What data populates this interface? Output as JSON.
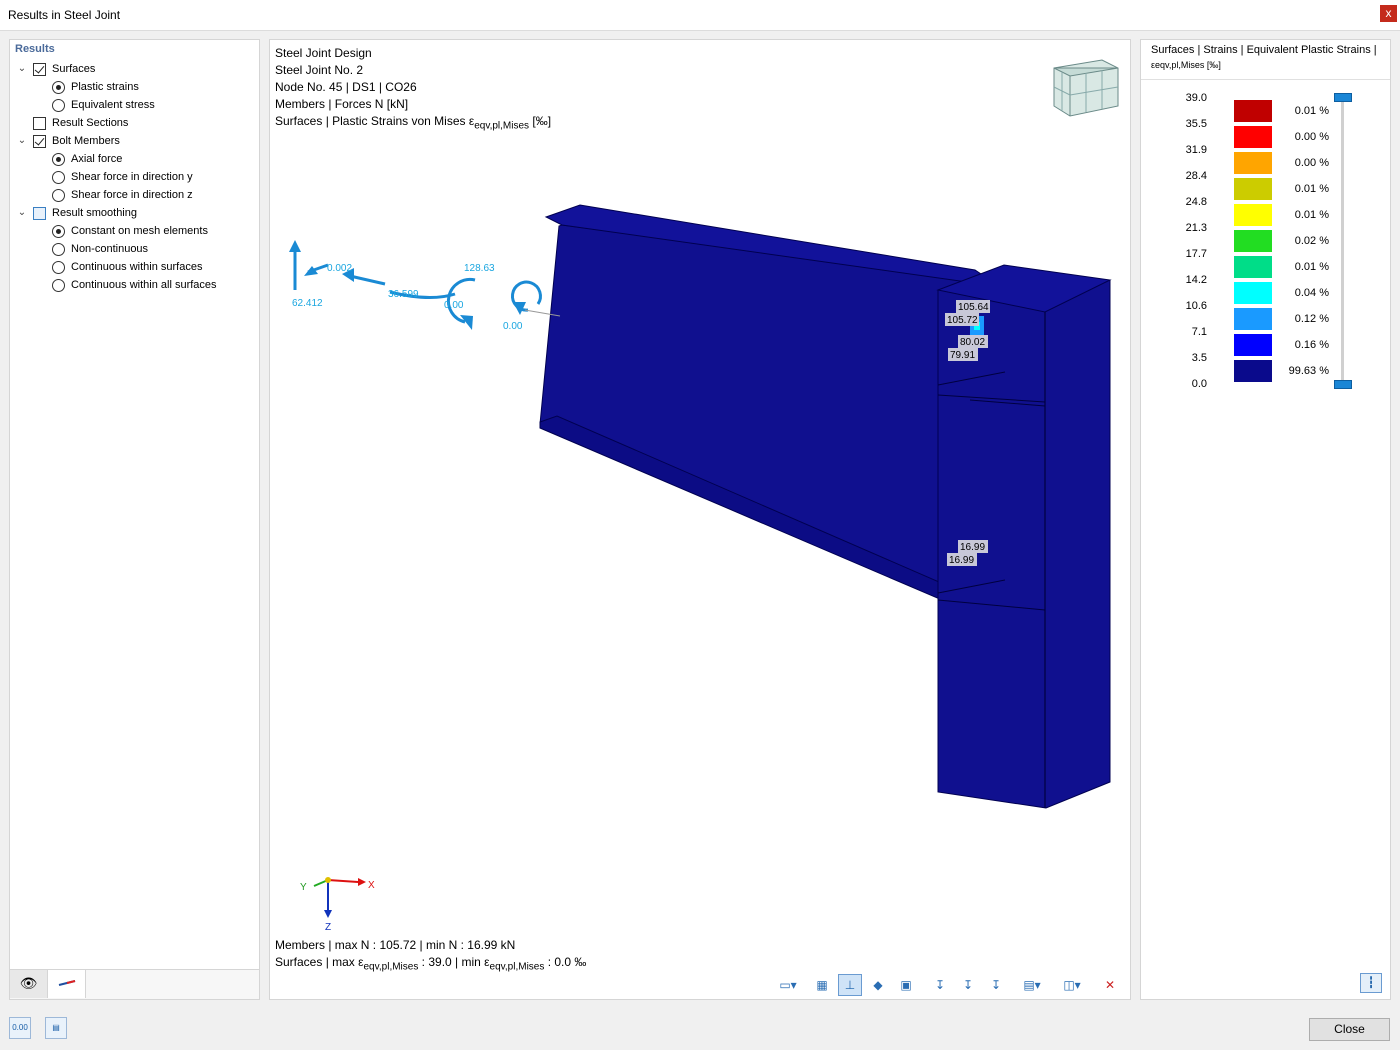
{
  "window": {
    "title": "Results in Steel Joint",
    "close_glyph": "x"
  },
  "tree": {
    "header": "Results",
    "items": [
      {
        "label": "Surfaces",
        "kind": "checkbox",
        "checked": true,
        "expander": true,
        "level": 0
      },
      {
        "label": "Plastic strains",
        "kind": "radio",
        "checked": true,
        "level": 1
      },
      {
        "label": "Equivalent stress",
        "kind": "radio",
        "checked": false,
        "level": 1
      },
      {
        "label": "Result Sections",
        "kind": "checkbox",
        "checked": false,
        "level": 0
      },
      {
        "label": "Bolt Members",
        "kind": "checkbox",
        "checked": true,
        "expander": true,
        "level": 0
      },
      {
        "label": "Axial force",
        "kind": "radio",
        "checked": true,
        "level": 1
      },
      {
        "label": "Shear force in direction y",
        "kind": "radio",
        "checked": false,
        "level": 1
      },
      {
        "label": "Shear force in direction z",
        "kind": "radio",
        "checked": false,
        "level": 1
      },
      {
        "label": "Result smoothing",
        "kind": "checkbox",
        "checked": false,
        "partial": true,
        "expander": true,
        "level": 0
      },
      {
        "label": "Constant on mesh elements",
        "kind": "radio",
        "checked": true,
        "level": 1
      },
      {
        "label": "Non-continuous",
        "kind": "radio",
        "checked": false,
        "level": 1
      },
      {
        "label": "Continuous within surfaces",
        "kind": "radio",
        "checked": false,
        "level": 1
      },
      {
        "label": "Continuous within all surfaces",
        "kind": "radio",
        "checked": false,
        "level": 1
      }
    ]
  },
  "viewport": {
    "info_lines": [
      "Steel Joint Design",
      "Steel Joint No. 2",
      "Node No. 45 | DS1 | CO26",
      "Members | Forces N [kN]"
    ],
    "surfaces_line_prefix": "Surfaces | Plastic Strains von Mises ε",
    "surfaces_line_sub": "eqv,pl,Mises",
    "surfaces_line_suffix": " [‰]",
    "footer_members": "Members | max N : 105.72 | min N : 16.99 kN",
    "footer_surf_a": "Surfaces | max ε",
    "footer_surf_sub1": "eqv,pl,Mises",
    "footer_surf_b": " : 39.0 | min ε",
    "footer_surf_sub2": "eqv,pl,Mises",
    "footer_surf_c": " : 0.0 ‰",
    "load_labels": [
      "0.002",
      "62.412",
      "36.599",
      "0.00",
      "128.63",
      "0.00"
    ],
    "result_labels": [
      "105.64",
      "105.72",
      "80.02",
      "79.91",
      "16.99",
      "16.99"
    ],
    "axis_labels": {
      "x": "X",
      "y": "Y",
      "z": "Z"
    },
    "model_color": "#0f0f96",
    "load_color": "#1a8ad4"
  },
  "legend": {
    "title": "Surfaces | Strains | Equivalent Plastic Strains |",
    "subtitle": "εeqv,pl,Mises [‰]",
    "values": [
      "39.0",
      "35.5",
      "31.9",
      "28.4",
      "24.8",
      "21.3",
      "17.7",
      "14.2",
      "10.6",
      "7.1",
      "3.5",
      "0.0"
    ],
    "bands": [
      {
        "color": "#c00000",
        "pct": "0.01 %"
      },
      {
        "color": "#ff0000",
        "pct": "0.00 %"
      },
      {
        "color": "#ffa500",
        "pct": "0.00 %"
      },
      {
        "color": "#cccc00",
        "pct": "0.01 %"
      },
      {
        "color": "#ffff00",
        "pct": "0.01 %"
      },
      {
        "color": "#22dd22",
        "pct": "0.02 %"
      },
      {
        "color": "#00dd88",
        "pct": "0.01 %"
      },
      {
        "color": "#00ffff",
        "pct": "0.04 %"
      },
      {
        "color": "#1a9aff",
        "pct": "0.12 %"
      },
      {
        "color": "#0000ff",
        "pct": "0.16 %"
      },
      {
        "color": "#0a0a8c",
        "pct": "99.63 %"
      }
    ]
  },
  "bottom": {
    "close_label": "Close",
    "icon1_text": "0.00"
  }
}
